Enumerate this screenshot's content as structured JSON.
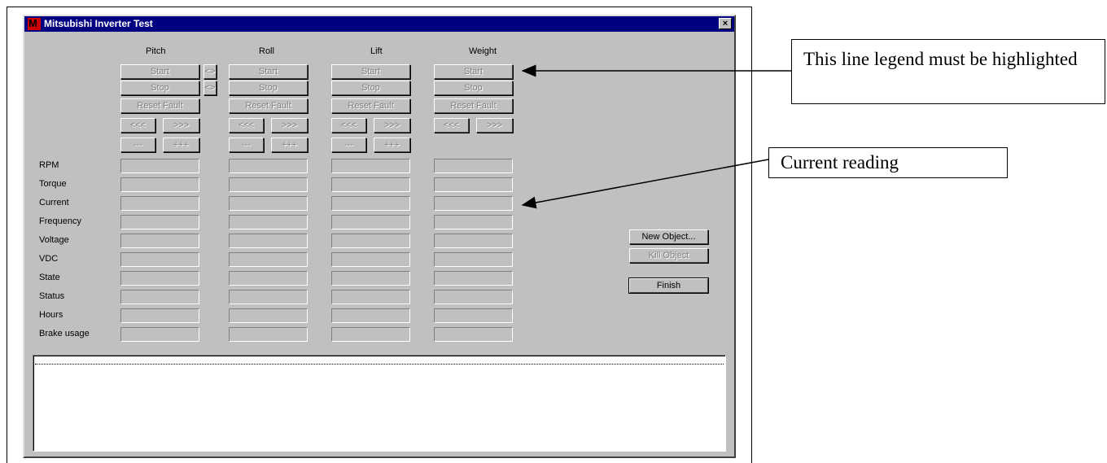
{
  "window": {
    "title": "Mitsubishi Inverter Test",
    "close_label": "×"
  },
  "columns": [
    "Pitch",
    "Roll",
    "Lift",
    "Weight"
  ],
  "buttons": {
    "start": "Start",
    "stop": "Stop",
    "reset_fault": "Reset Fault",
    "left": "<<<",
    "right": ">>>",
    "minus": "---",
    "plus": "+++",
    "swap": "<>"
  },
  "rows": [
    "RPM",
    "Torque",
    "Current",
    "Frequency",
    "Voltage",
    "VDC",
    "State",
    "Status",
    "Hours",
    "Brake usage"
  ],
  "side_buttons": {
    "new_object": "New Object...",
    "kill_object": "Kill Object",
    "finish": "Finish"
  },
  "callouts": {
    "legend": "This line legend must be highlighted",
    "current": "Current reading"
  }
}
